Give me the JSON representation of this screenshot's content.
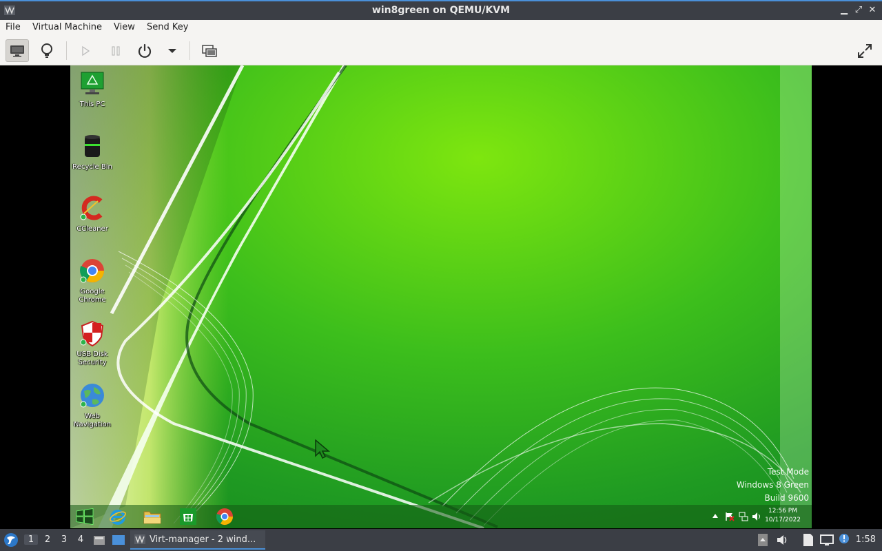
{
  "window": {
    "title": "win8green on QEMU/KVM",
    "controls": {
      "minimize": "▁",
      "maximize": "⤢",
      "close": "✕"
    }
  },
  "menu": [
    "File",
    "Virtual Machine",
    "View",
    "Send Key"
  ],
  "toolbar": {
    "buttons": [
      "console",
      "details",
      "run",
      "pause",
      "shutdown",
      "shutdown-menu",
      "snapshots",
      "fullscreen"
    ]
  },
  "guest": {
    "desktop_icons": [
      {
        "label": "This PC"
      },
      {
        "label": "Recycle Bin"
      },
      {
        "label": "CCleaner"
      },
      {
        "label": "Google Chrome"
      },
      {
        "label": "USB Disk Security"
      },
      {
        "label": "Web Navigation"
      }
    ],
    "watermark": {
      "line1": "Test Mode",
      "line2": "Windows 8 Green",
      "line3": "Build 9600"
    },
    "taskbar": {
      "pinned": [
        "start",
        "internet-explorer",
        "file-explorer",
        "store",
        "chrome"
      ],
      "time": "12:56 PM",
      "date": "10/17/2022"
    }
  },
  "panel": {
    "workspaces": [
      "1",
      "2",
      "3",
      "4"
    ],
    "active_workspace": "1",
    "task_label": "Virt-manager - 2 wind...",
    "clock": "1:58"
  },
  "colors": {
    "host_dark": "#3b3e45",
    "accent": "#4a90d9",
    "toolbar_bg": "#f5f4f2",
    "wallpaper_green": "#3fbf1a"
  }
}
